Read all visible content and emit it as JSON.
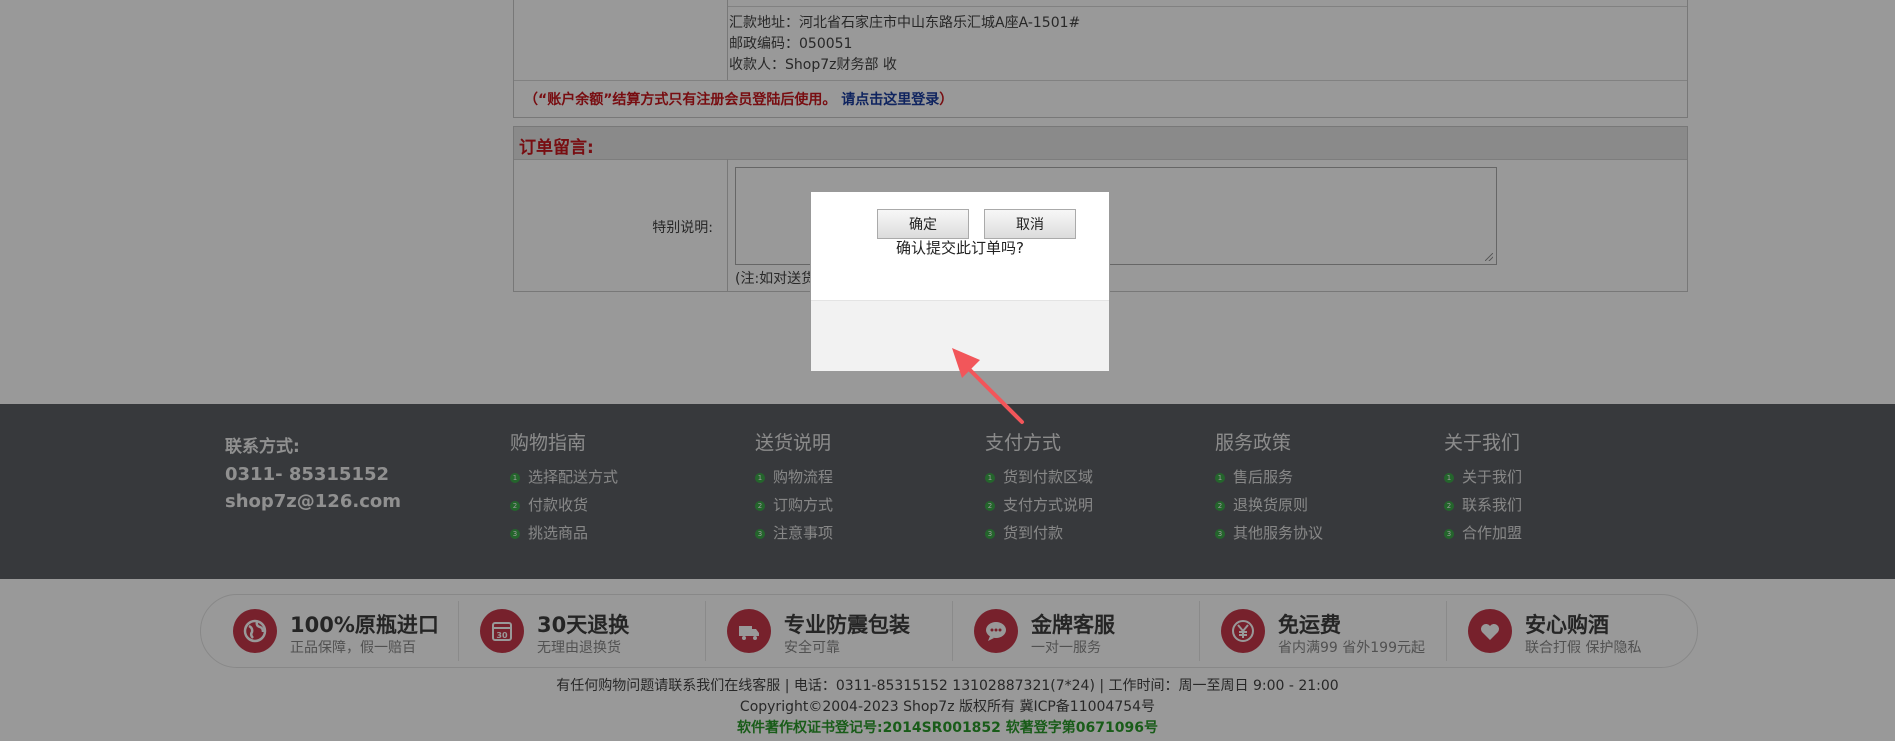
{
  "payment": {
    "address_line": "汇款地址：河北省石家庄市中山东路乐汇城A座A-1501#",
    "postcode_line": "邮政编码：050051",
    "payee_line": "收款人：Shop7z财务部 收",
    "notice_text": "（“账户余额”结算方式只有注册会员登陆后使用。",
    "login_link": "请点击这里登录",
    "notice_close": "）"
  },
  "order_message": {
    "title": "订单留言:",
    "label": "特别说明:",
    "note": "(注:如对送货"
  },
  "dialog": {
    "message": "确认提交此订单吗?",
    "confirm_label": "确定",
    "cancel_label": "取消"
  },
  "footer": {
    "contact": {
      "title": "联系方式:",
      "phone": "0311- 85315152",
      "email": "shop7z@126.com"
    },
    "columns": [
      {
        "heading": "购物指南",
        "items": [
          "选择配送方式",
          "付款收货",
          "挑选商品"
        ]
      },
      {
        "heading": "送货说明",
        "items": [
          "购物流程",
          "订购方式",
          "注意事项"
        ]
      },
      {
        "heading": "支付方式",
        "items": [
          "货到付款区域",
          "支付方式说明",
          "货到付款"
        ]
      },
      {
        "heading": "服务政策",
        "items": [
          "售后服务",
          "退换货原则",
          "其他服务协议"
        ]
      },
      {
        "heading": "关于我们",
        "items": [
          "关于我们",
          "联系我们",
          "合作加盟"
        ]
      }
    ],
    "number_badges": [
      "1",
      "2",
      "3"
    ]
  },
  "features": [
    {
      "icon": "globe-icon",
      "title": "100%原瓶进口",
      "subtitle": "正品保障，假一赔百"
    },
    {
      "icon": "calendar-30-icon",
      "title": "30天退换",
      "subtitle": "无理由退换货"
    },
    {
      "icon": "truck-icon",
      "title": "专业防震包装",
      "subtitle": "安全可靠"
    },
    {
      "icon": "chat-bubble-icon",
      "title": "金牌客服",
      "subtitle": "一对一服务"
    },
    {
      "icon": "yen-icon",
      "title": "免运费",
      "subtitle": "省内满99 省外199元起"
    },
    {
      "icon": "heart-icon",
      "title": "安心购酒",
      "subtitle": "联合打假 保护隐私"
    }
  ],
  "bottom": {
    "service_line": "有任何购物问题请联系我们在线客服 | 电话：0311-85315152 13102887321(7*24) | 工作时间：周一至周日 9:00 - 21:00",
    "copyright_line": "Copyright©2004-2023 Shop7z 版权所有   冀ICP备11004754号",
    "registration_line": "软件著作权证书登记号:2014SR001852 软著登字第0671096号"
  },
  "colors": {
    "accent_red": "#c8161d",
    "link_blue": "#1a3c9e",
    "footer_dark": "#5c6065",
    "feature_icon": "#c7384a",
    "badge_green": "#3ca84a",
    "registration_green": "#2a9a2a"
  }
}
